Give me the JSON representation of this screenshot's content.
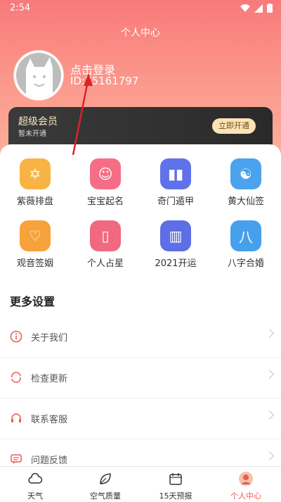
{
  "status": {
    "time": "2:54"
  },
  "header": {
    "title": "个人中心",
    "login_text": "点击登录",
    "user_id": "ID:75161797"
  },
  "vip": {
    "title": "超级会员",
    "subtitle": "暂未开通",
    "button": "立即开通"
  },
  "features": [
    {
      "label": "紫薇排盘",
      "icon": "star-of-david-icon",
      "color": "#f7b444"
    },
    {
      "label": "宝宝起名",
      "icon": "baby-face-icon",
      "color": "#f66e86"
    },
    {
      "label": "奇门遁甲",
      "icon": "book-icon",
      "color": "#5f72ea"
    },
    {
      "label": "黄大仙签",
      "icon": "yin-yang-icon",
      "color": "#4aa3ec"
    },
    {
      "label": "观音签姻",
      "icon": "heart-icon",
      "color": "#f7a23a"
    },
    {
      "label": "个人占星",
      "icon": "card-icon",
      "color": "#f06980"
    },
    {
      "label": "2021开运",
      "icon": "panel-icon",
      "color": "#5d6ee6"
    },
    {
      "label": "八字合婚",
      "icon": "bazi-icon",
      "color": "#46a0ec",
      "glyph": "八"
    }
  ],
  "more_settings": {
    "title": "更多设置"
  },
  "settings": [
    {
      "label": "关于我们",
      "icon": "info-icon"
    },
    {
      "label": "检查更新",
      "icon": "refresh-icon"
    },
    {
      "label": "联系客服",
      "icon": "headset-icon"
    },
    {
      "label": "问题反馈",
      "icon": "feedback-icon"
    }
  ],
  "tabs": [
    {
      "label": "天气",
      "icon": "cloud-icon",
      "active": false
    },
    {
      "label": "空气质量",
      "icon": "leaf-icon",
      "active": false
    },
    {
      "label": "15天预报",
      "icon": "calendar-icon",
      "active": false
    },
    {
      "label": "个人中心",
      "icon": "person-icon",
      "active": true
    }
  ]
}
